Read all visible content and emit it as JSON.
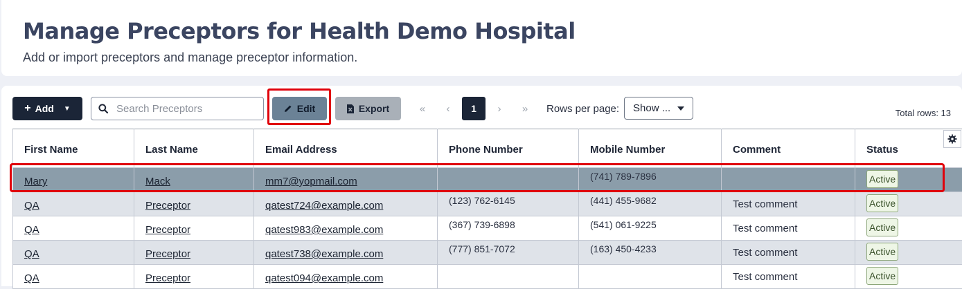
{
  "header": {
    "title": "Manage Preceptors for Health Demo Hospital",
    "subtitle": "Add or import preceptors and manage preceptor information."
  },
  "toolbar": {
    "add_label": "Add",
    "search_placeholder": "Search Preceptors",
    "edit_label": "Edit",
    "export_label": "Export",
    "pagination": {
      "first": "«",
      "prev": "‹",
      "current_page": "1",
      "next": "›",
      "last": "»"
    },
    "rows_per_page_label": "Rows per page:",
    "rows_per_page_value": "Show ...",
    "total_rows": "Total rows: 13"
  },
  "table": {
    "columns": [
      "First Name",
      "Last Name",
      "Email Address",
      "Phone Number",
      "Mobile Number",
      "Comment",
      "Status"
    ],
    "rows": [
      {
        "first": "Mary",
        "last": "Mack",
        "email": "mm7@yopmail.com",
        "phone": "",
        "mobile": "(741) 789-7896",
        "comment": "",
        "status": "Active"
      },
      {
        "first": "QA",
        "last": "Preceptor",
        "email": "qatest724@example.com",
        "phone": "(123) 762-6145",
        "mobile": "(441) 455-9682",
        "comment": "Test comment",
        "status": "Active"
      },
      {
        "first": "QA",
        "last": "Preceptor",
        "email": "qatest983@example.com",
        "phone": "(367) 739-6898",
        "mobile": "(541) 061-9225",
        "comment": "Test comment",
        "status": "Active"
      },
      {
        "first": "QA",
        "last": "Preceptor",
        "email": "qatest738@example.com",
        "phone": "(777) 851-7072",
        "mobile": "(163) 450-4233",
        "comment": "Test comment",
        "status": "Active"
      },
      {
        "first": "QA",
        "last": "Preceptor",
        "email": "qatest094@example.com",
        "phone": "",
        "mobile": "",
        "comment": "Test comment",
        "status": "Active"
      }
    ]
  },
  "colors": {
    "primary_dark": "#1b2537",
    "highlight_red": "#e0000a",
    "selected_row": "#8b9daa",
    "status_green": "#8da77a"
  },
  "icons": {
    "add": "plus-icon",
    "search": "search-icon",
    "edit": "pencil-icon",
    "export": "excel-file-icon",
    "settings": "gear-icon"
  }
}
